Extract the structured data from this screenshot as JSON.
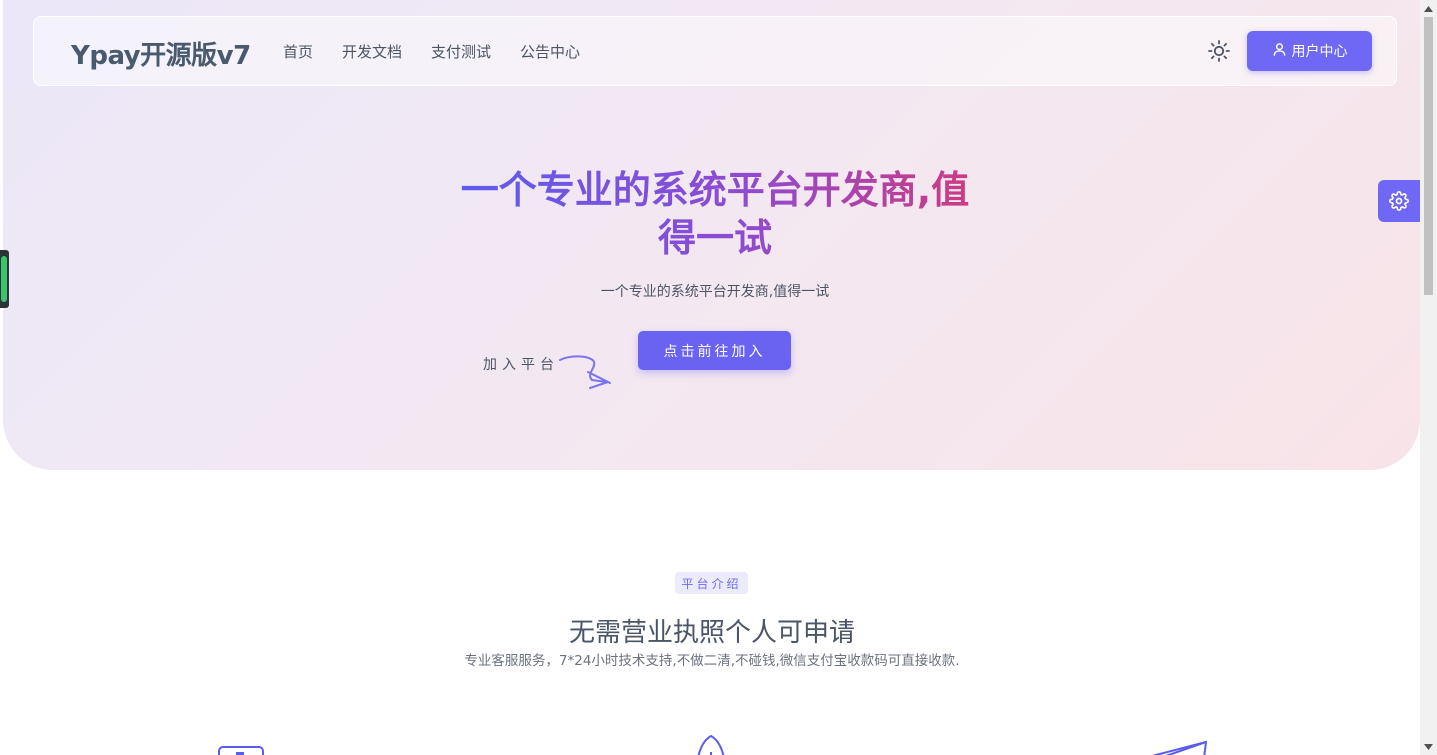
{
  "nav": {
    "brand": "Ypay开源版v7",
    "links": [
      "首页",
      "开发文档",
      "支付测试",
      "公告中心"
    ],
    "user_button": "用户中心",
    "theme_icon": "sun-icon"
  },
  "hero": {
    "headline_line1": "一个专业的系统平台开发商,值",
    "headline_line2": "得一试",
    "subheading": "一个专业的系统平台开发商,值得一试",
    "join_label": "加入平台",
    "join_button": "点击前往加入"
  },
  "intro": {
    "badge": "平台介绍",
    "title": "无需营业执照个人可申请",
    "subtitle": "专业客服服务，7*24小时技术支持,不做二清,不碰钱,微信支付宝收款码可直接收款."
  },
  "colors": {
    "accent": "#6f68f5",
    "gradient_start": "#5a5cf0",
    "gradient_end": "#d03a7d",
    "handle_green": "#3cc46b"
  }
}
